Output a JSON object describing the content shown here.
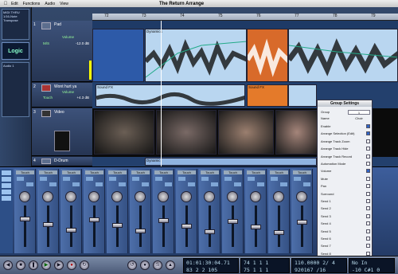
{
  "window": {
    "title": "The Return Arrange"
  },
  "menu": {
    "apple": "",
    "items": [
      "Edit",
      "Functions",
      "Audio",
      "View"
    ]
  },
  "inspector": {
    "midi_thru": "MIDI THRU",
    "quant": "1/16-Note",
    "transpose": "Transpose",
    "audio": "Audio 1",
    "logo_text": "Logic"
  },
  "ruler": {
    "ticks": [
      "72",
      "73",
      "74",
      "75",
      "76",
      "77",
      "78",
      "79"
    ]
  },
  "tracks": [
    {
      "num": "1",
      "name": "Pad",
      "sub": "Volume",
      "val": "-12.0 dB",
      "aux": "M/S"
    },
    {
      "num": "2",
      "name": "Wont hurt ya",
      "sub": "Touch",
      "val": "+4.3 dB",
      "aux": "Volume"
    },
    {
      "num": "3",
      "name": "Video",
      "sub": "",
      "val": "",
      "aux": ""
    },
    {
      "num": "4",
      "name": "D-Drum",
      "sub": "",
      "val": "",
      "aux": ""
    }
  ],
  "regions": {
    "dynamics": "Dynamics",
    "soundfx_a": "Sound FX",
    "soundfx_b": "Sound FX",
    "dynamic": "Dynamic"
  },
  "dialog": {
    "title": "Group Settings",
    "group_label": "Group",
    "group_value": "1",
    "name_label": "Name",
    "name_value": "Choir",
    "rows": [
      {
        "label": "Enable",
        "checked": true
      },
      {
        "label": "Arrange Selection (Edit)",
        "checked": true
      },
      {
        "label": "Arrange Track Zoom",
        "checked": false
      },
      {
        "label": "Arrange Track Hide",
        "checked": false
      },
      {
        "label": "Arrange Track Record",
        "checked": false
      },
      {
        "label": "Automation Mode",
        "checked": false
      },
      {
        "label": "Volume",
        "checked": true
      },
      {
        "label": "Mute",
        "checked": false
      },
      {
        "label": "Pan",
        "checked": false
      },
      {
        "label": "Surround",
        "checked": false
      },
      {
        "label": "Send 1",
        "checked": false
      },
      {
        "label": "Send 2",
        "checked": false
      },
      {
        "label": "Send 3",
        "checked": false
      },
      {
        "label": "Send 4",
        "checked": false
      },
      {
        "label": "Send 5",
        "checked": false
      },
      {
        "label": "Send 6",
        "checked": false
      },
      {
        "label": "Send 7",
        "checked": false
      },
      {
        "label": "Send 8",
        "checked": false
      }
    ]
  },
  "mixer": {
    "strip_mode": "Touch",
    "strip_count": 13
  },
  "transport": {
    "smpte": "01:01:30:04.71",
    "smpte2": "83  2  2  105",
    "pos": "74   1   1   1",
    "pos2": "75   1   1   1",
    "tempo": "110.0000",
    "tempo2": "920167",
    "sig": "2/ 4",
    "sig2": "/16",
    "in": "No In",
    "out": "-10 C#1  0"
  }
}
